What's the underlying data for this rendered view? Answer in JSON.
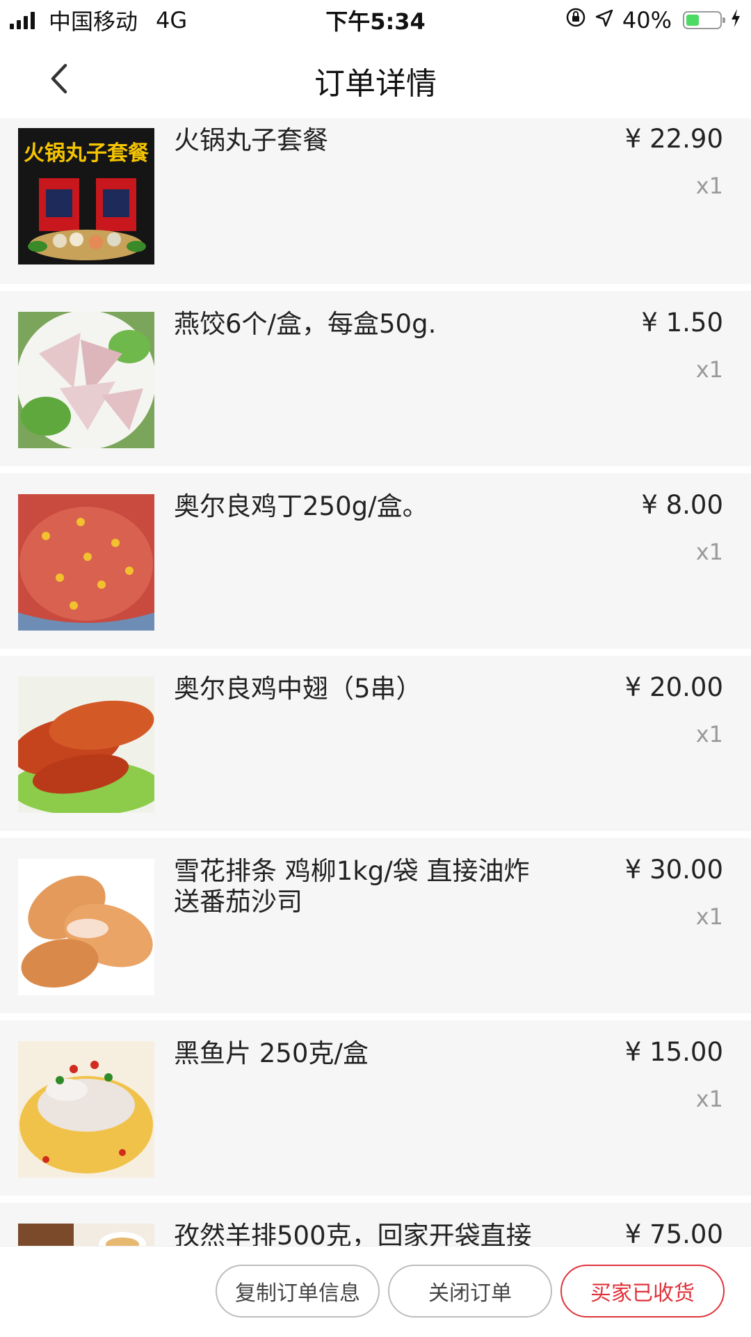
{
  "status_bar": {
    "carrier": "中国移动",
    "network": "4G",
    "time": "下午5:34",
    "battery": "40%",
    "battery_level": 0.4
  },
  "nav": {
    "title": "订单详情",
    "back_icon": "chevron-left-icon"
  },
  "items": [
    {
      "name": "火锅丸子套餐",
      "price": "¥ 22.90",
      "qty": "x1",
      "thumb_label": "火锅丸子套餐"
    },
    {
      "name": "燕饺6个/盒，每盒50g.",
      "price": "¥ 1.50",
      "qty": "x1"
    },
    {
      "name": "奥尔良鸡丁250g/盒。",
      "price": "¥ 8.00",
      "qty": "x1"
    },
    {
      "name": "奥尔良鸡中翅（5串）",
      "price": "¥ 20.00",
      "qty": "x1"
    },
    {
      "name": "雪花排条 鸡柳1kg/袋 直接油炸 送番茄沙司",
      "price": "¥ 30.00",
      "qty": "x1"
    },
    {
      "name": "黑鱼片 250克/盒",
      "price": "¥ 15.00",
      "qty": "x1"
    },
    {
      "name": "孜然羊排500克，回家开袋直接",
      "price": "¥ 75.00",
      "qty": ""
    }
  ],
  "actions": {
    "copy": "复制订单信息",
    "close": "关闭订单",
    "received": "买家已收货"
  },
  "colors": {
    "accent": "#e0323a",
    "battery": "#4cd964",
    "item_bg": "#f6f6f6"
  }
}
